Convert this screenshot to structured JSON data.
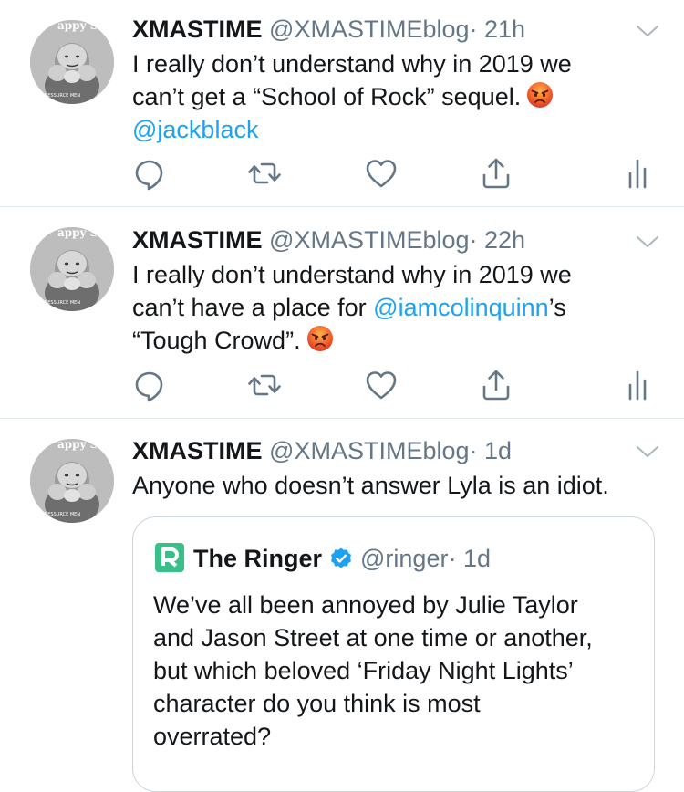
{
  "tweets": [
    {
      "name": "XMASTIME",
      "handle": "@XMASTIMEblog",
      "dot": "·",
      "time": "21h",
      "line1": "I really don’t understand why in 2019 we",
      "line2": "can’t get a “School of Rock” sequel.",
      "line3_mention": "@jackblack"
    },
    {
      "name": "XMASTIME",
      "handle": "@XMASTIMEblog",
      "dot": "·",
      "time": "22h",
      "line1": "I really don’t understand why in 2019 we",
      "line2_pre": "can’t have a place for ",
      "line2_mention": "@iamcolinquinn",
      "line2_post": "’s",
      "line3": "“Tough Crowd”."
    },
    {
      "name": "XMASTIME",
      "handle": "@XMASTIMEblog",
      "dot": "·",
      "time": "1d",
      "line1": "Anyone who doesn’t answer Lyla is an idiot."
    }
  ],
  "quote": {
    "name": "The Ringer",
    "handle": "@ringer",
    "dot": "·",
    "time": "1d",
    "lines": [
      "We’ve all been annoyed by Julie Taylor",
      "and Jason Street at one time or another,",
      "but which beloved ‘Friday Night Lights’",
      "character do you think is most",
      "overrated?"
    ]
  },
  "avatar_text": {
    "top": "appy Sce",
    "bottom": "PE RESSURCE MEN"
  },
  "colors": {
    "text": "#14171a",
    "secondary": "#657786",
    "link": "#1da1f2",
    "divider": "#e1e8ed",
    "icon": "#657786",
    "ringer_green": "#3bbf8a"
  },
  "icons": [
    "reply-icon",
    "retweet-icon",
    "like-icon",
    "share-icon",
    "analytics-icon",
    "chevron-down-icon",
    "angry-face-icon",
    "verified-badge-icon",
    "ringer-logo-icon"
  ]
}
